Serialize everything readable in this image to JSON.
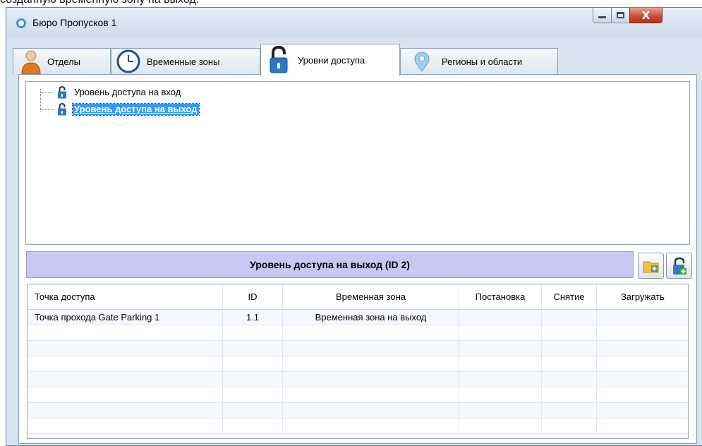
{
  "caption": "созданную временную зону на выход.",
  "window": {
    "title": "Бюро Пропусков 1",
    "controls": {
      "minimize": "",
      "maximize": "",
      "close": "X"
    }
  },
  "tabs": [
    {
      "label": "Отделы",
      "icon": "person-icon"
    },
    {
      "label": "Временные зоны",
      "icon": "clock-icon"
    },
    {
      "label": "Уровни доступа",
      "icon": "lock-icon",
      "active": true
    },
    {
      "label": "Регионы и области",
      "icon": "pin-icon"
    }
  ],
  "tree": {
    "items": [
      {
        "label": "Уровень доступа на вход",
        "icon": "lock-icon"
      },
      {
        "label": "Уровень доступа на выход",
        "icon": "lock-icon",
        "selected": true
      }
    ]
  },
  "detail": {
    "header": "Уровень доступа на выход (ID 2)",
    "add_folder_icon": "folder-add-icon",
    "add_lock_icon": "lock-add-icon"
  },
  "grid": {
    "columns": [
      "Точка доступа",
      "ID",
      "Временная зона",
      "Постановка",
      "Снятие",
      "Загружать"
    ],
    "rows": [
      [
        "Точка прохода Gate Parking 1",
        "1.1",
        "Временная зона на выход",
        "",
        "",
        ""
      ]
    ]
  },
  "colors": {
    "header_bg": "#c9c8f3",
    "selection": "#3399ff",
    "window_bg": "#d9e4f1",
    "close_button": "#c75038"
  }
}
